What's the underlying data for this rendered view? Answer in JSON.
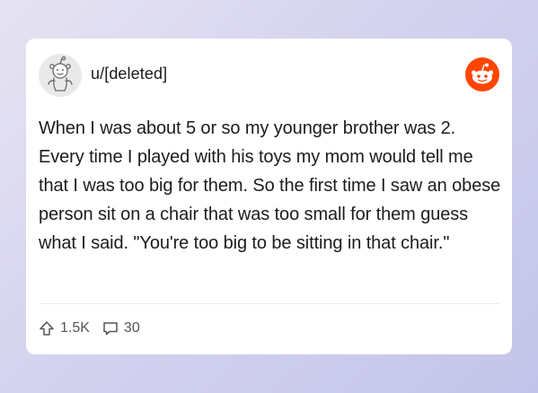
{
  "post": {
    "username": "u/[deleted]",
    "body": "When I was about 5 or so my younger brother was 2. Every time I played with his toys my mom would tell me that I was too big for them. So the first time I saw an obese person sit on a chair that was too small for them guess what I said. \"You're too big to be sitting in that chair.\"",
    "upvotes": "1.5K",
    "comments": "30"
  },
  "icons": {
    "avatar": "snoo-avatar-icon",
    "brand": "reddit-logo-icon",
    "upvote": "upvote-arrow-icon",
    "comment": "comment-bubble-icon"
  },
  "colors": {
    "brand": "#ff4500",
    "text": "#1c1c1c",
    "muted": "#555555",
    "card": "#ffffff"
  }
}
